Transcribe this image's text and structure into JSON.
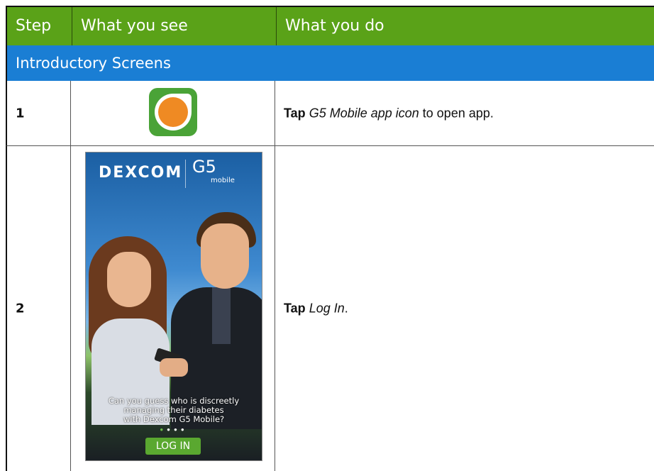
{
  "header": {
    "step": "Step",
    "what_you_see": "What you see",
    "what_you_do": "What you do"
  },
  "section_title": "Introductory Screens",
  "rows": [
    {
      "step": "1",
      "visual": "app-icon",
      "action_bold": "Tap",
      "action_italic": "G5 Mobile app icon",
      "action_rest": " to open app."
    },
    {
      "step": "2",
      "visual": "phone-screen",
      "action_bold": "Tap",
      "action_italic": "Log In",
      "action_rest": "."
    }
  ],
  "phone_screen": {
    "brand": "DEXCOM",
    "product": "G5",
    "product_sub": "mobile",
    "caption_line1": "Can you guess who is discreetly",
    "caption_line2": "managing their diabetes",
    "caption_line3": "with Dexcom G5 Mobile?",
    "login_label": "LOG IN"
  },
  "colors": {
    "header_bg": "#5aa218",
    "section_bg": "#1a7ed4",
    "app_icon_bg": "#4aa337",
    "app_icon_dot": "#ef8a23"
  }
}
